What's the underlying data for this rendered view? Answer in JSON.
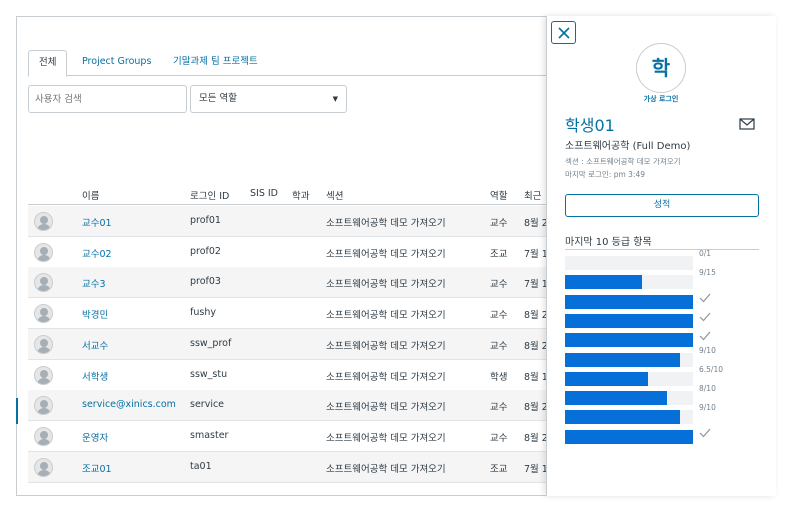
{
  "tabs": [
    {
      "label": "전체",
      "active": true
    },
    {
      "label": "Project Groups",
      "active": false
    },
    {
      "label": "기말과제 팀 프로젝트",
      "active": false
    }
  ],
  "filters": {
    "search_placeholder": "사용자 검색",
    "role_selected": "모든 역할"
  },
  "table": {
    "headers": {
      "name": "이름",
      "login": "로그인 ID",
      "sis": "SIS ID",
      "dept": "학과",
      "section": "섹션",
      "role": "역할",
      "recent": "최근"
    },
    "rows": [
      {
        "name": "교수01",
        "login": "prof01",
        "section": "소프트웨어공학 데모 가져오기",
        "role": "교수",
        "recent": "8월 2"
      },
      {
        "name": "교수02",
        "login": "prof02",
        "section": "소프트웨어공학 데모 가져오기",
        "role": "조교",
        "recent": "7월 1"
      },
      {
        "name": "교수3",
        "login": "prof03",
        "section": "소프트웨어공학 데모 가져오기",
        "role": "교수",
        "recent": "7월 1"
      },
      {
        "name": "박경민",
        "login": "fushy",
        "section": "소프트웨어공학 데모 가져오기",
        "role": "교수",
        "recent": "8월 2"
      },
      {
        "name": "서교수",
        "login": "ssw_prof",
        "section": "소프트웨어공학 데모 가져오기",
        "role": "교수",
        "recent": "8월 2"
      },
      {
        "name": "서학생",
        "login": "ssw_stu",
        "section": "소프트웨어공학 데모 가져오기",
        "role": "학생",
        "recent": "8월 1"
      },
      {
        "name": "service@xinics.com",
        "login": "service",
        "section": "소프트웨어공학 데모 가져오기",
        "role": "교수",
        "recent": "8월 2"
      },
      {
        "name": "운영자",
        "login": "smaster",
        "section": "소프트웨어공학 데모 가져오기",
        "role": "교수",
        "recent": "8월 2"
      },
      {
        "name": "조교01",
        "login": "ta01",
        "section": "소프트웨어공학 데모 가져오기",
        "role": "조교",
        "recent": "7월 1"
      }
    ]
  },
  "tray": {
    "avatar_initial": "학",
    "masquerade_label": "가상 로그인",
    "student_name": "학생01",
    "course_name": "소프트웨어공학 (Full Demo)",
    "section_line": "섹션 : 소프트웨어공학 데모 가져오기",
    "last_login_line": "마지막 로그인: pm 3:49",
    "grades_button": "성적",
    "recent_grades_title": "마지막 10 등급 항목",
    "grades": [
      {
        "fraction": 0.0,
        "label": "0/1"
      },
      {
        "fraction": 0.6,
        "label": "9/15"
      },
      {
        "fraction": 1.0,
        "label": "",
        "check": true
      },
      {
        "fraction": 1.0,
        "label": "",
        "check": true
      },
      {
        "fraction": 1.0,
        "label": "",
        "check": true
      },
      {
        "fraction": 0.9,
        "label": "9/10"
      },
      {
        "fraction": 0.65,
        "label": "6.5/10"
      },
      {
        "fraction": 0.8,
        "label": "8/10"
      },
      {
        "fraction": 0.9,
        "label": "9/10"
      },
      {
        "fraction": 1.0,
        "label": "",
        "check": true
      }
    ]
  },
  "colors": {
    "link": "#0770a3",
    "bar": "#0770d8"
  }
}
